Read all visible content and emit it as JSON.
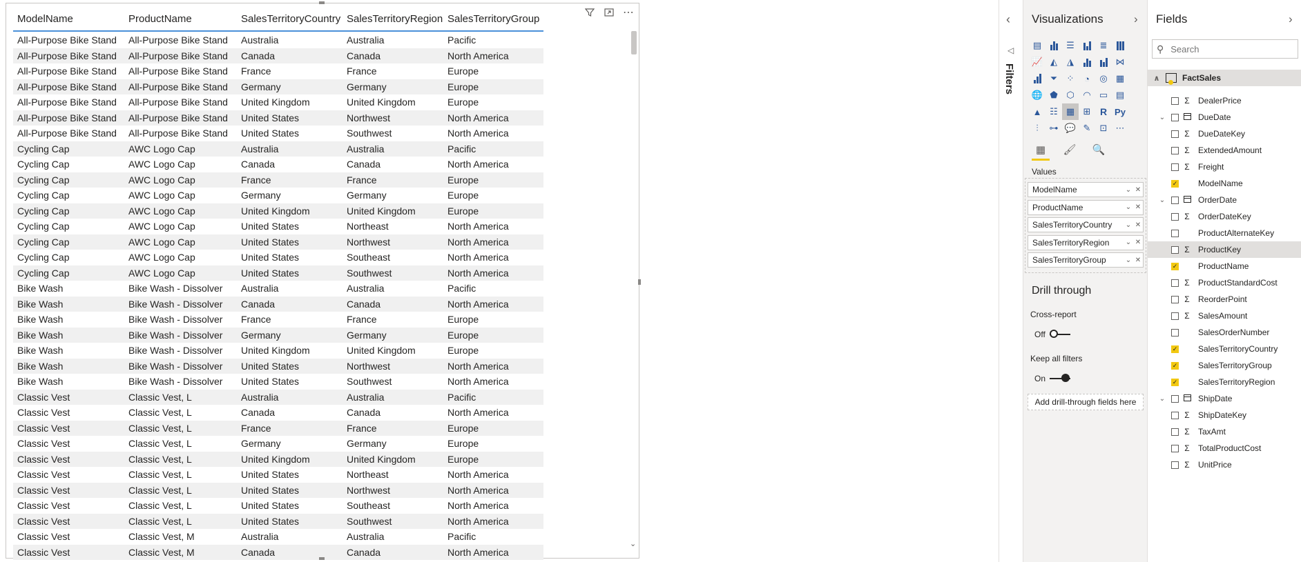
{
  "table": {
    "columns": [
      "ModelName",
      "ProductName",
      "SalesTerritoryCountry",
      "SalesTerritoryRegion",
      "SalesTerritoryGroup"
    ],
    "rows": [
      [
        "All-Purpose Bike Stand",
        "All-Purpose Bike Stand",
        "Australia",
        "Australia",
        "Pacific"
      ],
      [
        "All-Purpose Bike Stand",
        "All-Purpose Bike Stand",
        "Canada",
        "Canada",
        "North America"
      ],
      [
        "All-Purpose Bike Stand",
        "All-Purpose Bike Stand",
        "France",
        "France",
        "Europe"
      ],
      [
        "All-Purpose Bike Stand",
        "All-Purpose Bike Stand",
        "Germany",
        "Germany",
        "Europe"
      ],
      [
        "All-Purpose Bike Stand",
        "All-Purpose Bike Stand",
        "United Kingdom",
        "United Kingdom",
        "Europe"
      ],
      [
        "All-Purpose Bike Stand",
        "All-Purpose Bike Stand",
        "United States",
        "Northwest",
        "North America"
      ],
      [
        "All-Purpose Bike Stand",
        "All-Purpose Bike Stand",
        "United States",
        "Southwest",
        "North America"
      ],
      [
        "Cycling Cap",
        "AWC Logo Cap",
        "Australia",
        "Australia",
        "Pacific"
      ],
      [
        "Cycling Cap",
        "AWC Logo Cap",
        "Canada",
        "Canada",
        "North America"
      ],
      [
        "Cycling Cap",
        "AWC Logo Cap",
        "France",
        "France",
        "Europe"
      ],
      [
        "Cycling Cap",
        "AWC Logo Cap",
        "Germany",
        "Germany",
        "Europe"
      ],
      [
        "Cycling Cap",
        "AWC Logo Cap",
        "United Kingdom",
        "United Kingdom",
        "Europe"
      ],
      [
        "Cycling Cap",
        "AWC Logo Cap",
        "United States",
        "Northeast",
        "North America"
      ],
      [
        "Cycling Cap",
        "AWC Logo Cap",
        "United States",
        "Northwest",
        "North America"
      ],
      [
        "Cycling Cap",
        "AWC Logo Cap",
        "United States",
        "Southeast",
        "North America"
      ],
      [
        "Cycling Cap",
        "AWC Logo Cap",
        "United States",
        "Southwest",
        "North America"
      ],
      [
        "Bike Wash",
        "Bike Wash - Dissolver",
        "Australia",
        "Australia",
        "Pacific"
      ],
      [
        "Bike Wash",
        "Bike Wash - Dissolver",
        "Canada",
        "Canada",
        "North America"
      ],
      [
        "Bike Wash",
        "Bike Wash - Dissolver",
        "France",
        "France",
        "Europe"
      ],
      [
        "Bike Wash",
        "Bike Wash - Dissolver",
        "Germany",
        "Germany",
        "Europe"
      ],
      [
        "Bike Wash",
        "Bike Wash - Dissolver",
        "United Kingdom",
        "United Kingdom",
        "Europe"
      ],
      [
        "Bike Wash",
        "Bike Wash - Dissolver",
        "United States",
        "Northwest",
        "North America"
      ],
      [
        "Bike Wash",
        "Bike Wash - Dissolver",
        "United States",
        "Southwest",
        "North America"
      ],
      [
        "Classic Vest",
        "Classic Vest, L",
        "Australia",
        "Australia",
        "Pacific"
      ],
      [
        "Classic Vest",
        "Classic Vest, L",
        "Canada",
        "Canada",
        "North America"
      ],
      [
        "Classic Vest",
        "Classic Vest, L",
        "France",
        "France",
        "Europe"
      ],
      [
        "Classic Vest",
        "Classic Vest, L",
        "Germany",
        "Germany",
        "Europe"
      ],
      [
        "Classic Vest",
        "Classic Vest, L",
        "United Kingdom",
        "United Kingdom",
        "Europe"
      ],
      [
        "Classic Vest",
        "Classic Vest, L",
        "United States",
        "Northeast",
        "North America"
      ],
      [
        "Classic Vest",
        "Classic Vest, L",
        "United States",
        "Northwest",
        "North America"
      ],
      [
        "Classic Vest",
        "Classic Vest, L",
        "United States",
        "Southeast",
        "North America"
      ],
      [
        "Classic Vest",
        "Classic Vest, L",
        "United States",
        "Southwest",
        "North America"
      ],
      [
        "Classic Vest",
        "Classic Vest, M",
        "Australia",
        "Australia",
        "Pacific"
      ],
      [
        "Classic Vest",
        "Classic Vest, M",
        "Canada",
        "Canada",
        "North America"
      ]
    ]
  },
  "filters": {
    "label": "Filters"
  },
  "visualizations": {
    "title": "Visualizations",
    "values_label": "Values",
    "wells": [
      "ModelName",
      "ProductName",
      "SalesTerritoryCountry",
      "SalesTerritoryRegion",
      "SalesTerritoryGroup"
    ],
    "drill_through": {
      "title": "Drill through",
      "cross_report_label": "Cross-report",
      "cross_report_state": "Off",
      "keep_filters_label": "Keep all filters",
      "keep_filters_state": "On",
      "add_fields": "Add drill-through fields here"
    },
    "r_label": "R",
    "py_label": "Py"
  },
  "fields": {
    "title": "Fields",
    "search_placeholder": "Search",
    "table_name": "FactSales",
    "items": [
      {
        "name": "DealerPrice",
        "type": "sigma",
        "checked": false,
        "expand": false
      },
      {
        "name": "DueDate",
        "type": "calendar",
        "checked": false,
        "expand": true
      },
      {
        "name": "DueDateKey",
        "type": "sigma",
        "checked": false,
        "expand": false
      },
      {
        "name": "ExtendedAmount",
        "type": "sigma",
        "checked": false,
        "expand": false
      },
      {
        "name": "Freight",
        "type": "sigma",
        "checked": false,
        "expand": false
      },
      {
        "name": "ModelName",
        "type": "none",
        "checked": true,
        "expand": false
      },
      {
        "name": "OrderDate",
        "type": "calendar",
        "checked": false,
        "expand": true
      },
      {
        "name": "OrderDateKey",
        "type": "sigma",
        "checked": false,
        "expand": false
      },
      {
        "name": "ProductAlternateKey",
        "type": "none",
        "checked": false,
        "expand": false
      },
      {
        "name": "ProductKey",
        "type": "sigma",
        "checked": false,
        "expand": false,
        "highlight": true
      },
      {
        "name": "ProductName",
        "type": "none",
        "checked": true,
        "expand": false
      },
      {
        "name": "ProductStandardCost",
        "type": "sigma",
        "checked": false,
        "expand": false
      },
      {
        "name": "ReorderPoint",
        "type": "sigma",
        "checked": false,
        "expand": false
      },
      {
        "name": "SalesAmount",
        "type": "sigma",
        "checked": false,
        "expand": false
      },
      {
        "name": "SalesOrderNumber",
        "type": "none",
        "checked": false,
        "expand": false
      },
      {
        "name": "SalesTerritoryCountry",
        "type": "none",
        "checked": true,
        "expand": false
      },
      {
        "name": "SalesTerritoryGroup",
        "type": "none",
        "checked": true,
        "expand": false
      },
      {
        "name": "SalesTerritoryRegion",
        "type": "none",
        "checked": true,
        "expand": false
      },
      {
        "name": "ShipDate",
        "type": "calendar",
        "checked": false,
        "expand": true
      },
      {
        "name": "ShipDateKey",
        "type": "sigma",
        "checked": false,
        "expand": false
      },
      {
        "name": "TaxAmt",
        "type": "sigma",
        "checked": false,
        "expand": false
      },
      {
        "name": "TotalProductCost",
        "type": "sigma",
        "checked": false,
        "expand": false
      },
      {
        "name": "UnitPrice",
        "type": "sigma",
        "checked": false,
        "expand": false
      }
    ]
  },
  "colors": {
    "accent": "#f2c811",
    "header_underline": "#4a90d9",
    "viz_icon": "#2b579a"
  }
}
